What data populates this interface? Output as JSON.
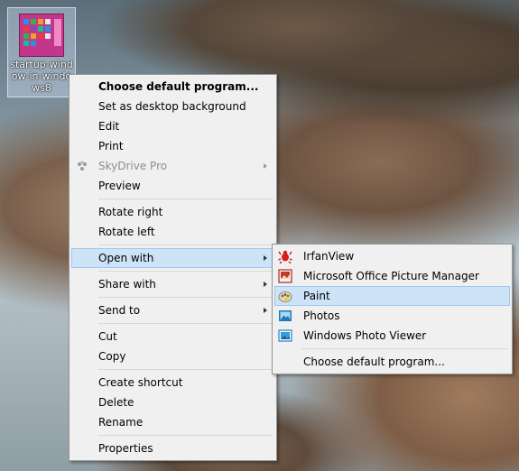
{
  "desktop": {
    "icon_label": "startup-window-in-windows8"
  },
  "context_menu": {
    "items": [
      {
        "label": "Choose default program...",
        "bold": true
      },
      {
        "label": "Set as desktop background"
      },
      {
        "label": "Edit"
      },
      {
        "label": "Print"
      },
      {
        "label": "SkyDrive Pro",
        "disabled": true,
        "submenu": true,
        "icon": "skydrive-icon"
      },
      {
        "label": "Preview"
      },
      {
        "label": "Rotate right"
      },
      {
        "label": "Rotate left"
      },
      {
        "label": "Open with",
        "submenu": true,
        "highlighted": true
      },
      {
        "label": "Share with",
        "submenu": true
      },
      {
        "label": "Send to",
        "submenu": true
      },
      {
        "label": "Cut"
      },
      {
        "label": "Copy"
      },
      {
        "label": "Create shortcut"
      },
      {
        "label": "Delete"
      },
      {
        "label": "Rename"
      },
      {
        "label": "Properties"
      }
    ]
  },
  "open_with_submenu": {
    "items": [
      {
        "label": "IrfanView",
        "icon": "irfanview-icon"
      },
      {
        "label": "Microsoft Office Picture Manager",
        "icon": "picture-manager-icon"
      },
      {
        "label": "Paint",
        "icon": "paint-icon",
        "highlighted": true
      },
      {
        "label": "Photos",
        "icon": "photos-icon"
      },
      {
        "label": "Windows Photo Viewer",
        "icon": "photo-viewer-icon"
      },
      {
        "label": "Choose default program..."
      }
    ]
  },
  "colors": {
    "menu_background": "#f0f0f0",
    "highlight": "#cde3f8",
    "highlight_border": "#9ec7ee"
  }
}
